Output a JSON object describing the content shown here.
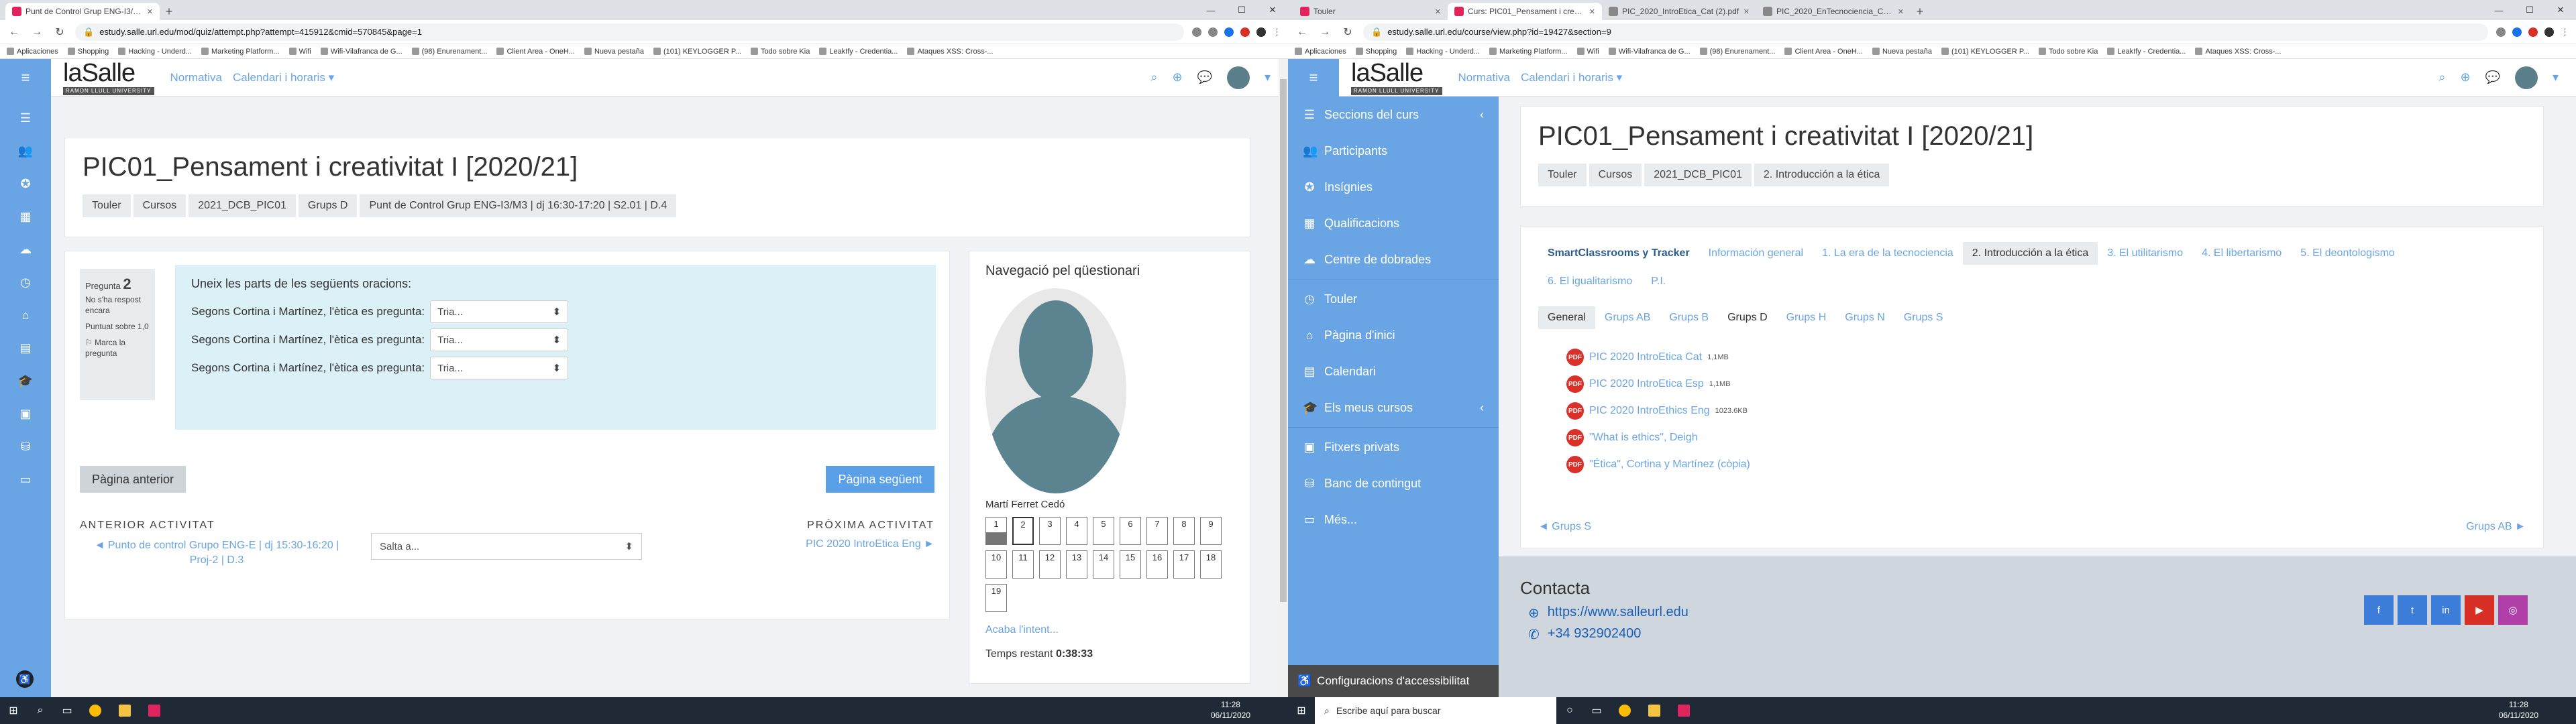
{
  "left": {
    "tabs": [
      {
        "title": "Punt de Control Grup ENG-I3/M3",
        "active": true
      }
    ],
    "url": "estudy.salle.url.edu/mod/quiz/attempt.php?attempt=415912&cmid=570845&page=1",
    "bookmarks": [
      "Aplicaciones",
      "Shopping",
      "Hacking - Underd...",
      "Marketing Platform...",
      "Wifi",
      "Wifi-Vilafranca de G...",
      "(98) Enurenament...",
      "Client Area - OneH...",
      "Nueva pestaña",
      "(101) KEYLOGGER P...",
      "Todo sobre Kia",
      "LeakIfy - Credentia...",
      "Ataques XSS: Cross-..."
    ],
    "header": {
      "logo": "laSalle",
      "logo_sub": "RAMON LLULL UNIVERSITY",
      "nav": [
        "Normativa",
        "Calendari i horaris ▾"
      ]
    },
    "course_title": "PIC01_Pensament i creativitat I [2020/21]",
    "breadcrumb": [
      "Touler",
      "Cursos",
      "2021_DCB_PIC01",
      "Grups D",
      "Punt de Control Grup ENG-I3/M3 | dj 16:30-17:20 | S2.01 | D.4"
    ],
    "question": {
      "label": "Pregunta",
      "number": "2",
      "status": "No s'ha respost encara",
      "score": "Puntuat sobre 1,0",
      "flag": "Marca la pregunta",
      "prompt": "Uneix les parts de les següents oracions:",
      "rows": [
        {
          "text": "Segons Cortina i Martínez, l'ètica es pregunta:",
          "select": "Tria..."
        },
        {
          "text": "Segons Cortina i Martínez, l'ètica es pregunta:",
          "select": "Tria..."
        },
        {
          "text": "Segons Cortina i Martínez, l'ètica es pregunta:",
          "select": "Tria..."
        }
      ]
    },
    "buttons": {
      "prev": "Pàgina anterior",
      "next": "Pàgina següent"
    },
    "activity": {
      "prev_label": "ANTERIOR ACTIVITAT",
      "prev_link": "◄ Punto de control Grupo ENG-E | dj 15:30-16:20 | Proj-2 | D.3",
      "jump": "Salta a...",
      "next_label": "PRÒXIMA ACTIVITAT",
      "next_link": "PIC 2020 IntroEtica Eng ►"
    },
    "quiznav": {
      "title": "Navegació pel qüestionari",
      "user": "Martí Ferret Cedó",
      "cells": [
        "1",
        "2",
        "3",
        "4",
        "5",
        "6",
        "7",
        "8",
        "9",
        "10",
        "11",
        "12",
        "13",
        "14",
        "15",
        "16",
        "17",
        "18",
        "19"
      ],
      "finish": "Acaba l'intent...",
      "timer_label": "Temps restant",
      "timer": "0:38:33"
    },
    "clock": {
      "time": "11:28",
      "date": "06/11/2020"
    }
  },
  "right": {
    "tabs": [
      {
        "title": "Touler",
        "active": false
      },
      {
        "title": "Curs: PIC01_Pensament i creati...",
        "active": true
      },
      {
        "title": "PIC_2020_IntroEtica_Cat (2).pdf",
        "active": false
      },
      {
        "title": "PIC_2020_EnTecnociencia_Cat.p...",
        "active": false
      }
    ],
    "url": "estudy.salle.url.edu/course/view.php?id=19427&section=9",
    "sidebar": [
      {
        "label": "Seccions del curs",
        "icon": "sitemap-icon",
        "chev": true
      },
      {
        "label": "Participants",
        "icon": "users-icon"
      },
      {
        "label": "Insígnies",
        "icon": "badge-icon"
      },
      {
        "label": "Qualificacions",
        "icon": "grades-icon"
      },
      {
        "label": "Centre de dobrades",
        "icon": "centre-icon"
      },
      {
        "label": "Touler",
        "icon": "dashboard-icon"
      },
      {
        "label": "Pàgina d'inici",
        "icon": "home-icon"
      },
      {
        "label": "Calendari",
        "icon": "calendar-icon"
      },
      {
        "label": "Els meus cursos",
        "icon": "courses-icon",
        "chev": true
      },
      {
        "label": "Fitxers privats",
        "icon": "files-icon"
      },
      {
        "label": "Banc de contingut",
        "icon": "bank-icon"
      },
      {
        "label": "Més...",
        "icon": "more-icon"
      }
    ],
    "accessibility": "Configuracions d'accessibilitat",
    "course_title": "PIC01_Pensament i creativitat I [2020/21]",
    "breadcrumb": [
      "Touler",
      "Cursos",
      "2021_DCB_PIC01",
      "2. Introducción a la ética"
    ],
    "sections": [
      "SmartClassrooms y Tracker",
      "Información general",
      "1. La era de la tecnociencia",
      "2. Introducción a la ética",
      "3. El utilitarismo",
      "4. El libertarismo",
      "5. El deontologismo",
      "6. El igualitarismo",
      "P.I."
    ],
    "groups": [
      "General",
      "Grups AB",
      "Grups B",
      "Grups D",
      "Grups H",
      "Grups N",
      "Grups S"
    ],
    "files": [
      {
        "name": "PIC 2020 IntroEtica Cat",
        "size": "1,1MB"
      },
      {
        "name": "PIC 2020 IntroEtica Esp",
        "size": "1,1MB"
      },
      {
        "name": "PIC 2020 IntroEthics Eng",
        "size": "1023.6KB"
      },
      {
        "name": "\"What is ethics\", Deigh",
        "size": ""
      },
      {
        "name": "\"Ética\", Cortina y Martínez (còpia)",
        "size": ""
      }
    ],
    "sec_prev": "◄ Grups S",
    "sec_next": "Grups AB ►",
    "contact": {
      "title": "Contacta",
      "web": "https://www.salleurl.edu",
      "tel": "+34 932902400"
    },
    "social": [
      "f",
      "t",
      "in",
      "▶",
      "◎"
    ],
    "search": "Escribe aquí para buscar",
    "clock": {
      "time": "11:28",
      "date": "06/11/2020"
    }
  },
  "colors": {
    "accent": "#69a5e4",
    "qbox": "#dcf0f8",
    "pdf": "#d9302a"
  }
}
